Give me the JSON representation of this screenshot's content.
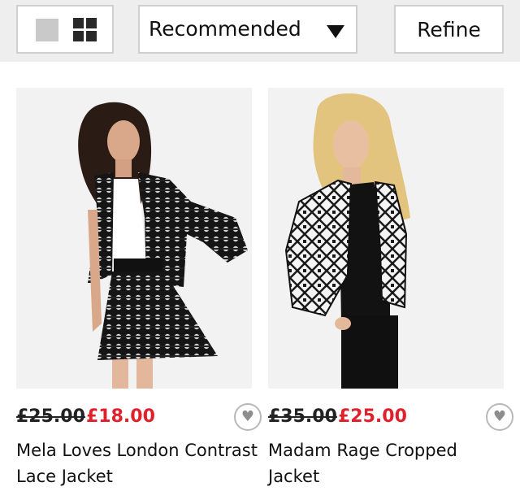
{
  "toolbar": {
    "view_single_icon": "single-view-icon",
    "view_grid_icon": "grid-view-icon",
    "sort": {
      "selected": "Recommended",
      "caret_icon": "caret-down-icon"
    },
    "refine_label": "Refine"
  },
  "products": [
    {
      "old_price": "£25.00",
      "new_price": "£18.00",
      "name": "Mela Loves London Contrast Lace Jacket",
      "heart_icon": "heart-icon"
    },
    {
      "old_price": "£35.00",
      "new_price": "£25.00",
      "name": "Madam Rage Cropped Jacket",
      "heart_icon": "heart-icon"
    }
  ],
  "colors": {
    "sale_price": "#e0202b",
    "toolbar_bg": "#eeeeee",
    "border": "#cfcfcf"
  }
}
